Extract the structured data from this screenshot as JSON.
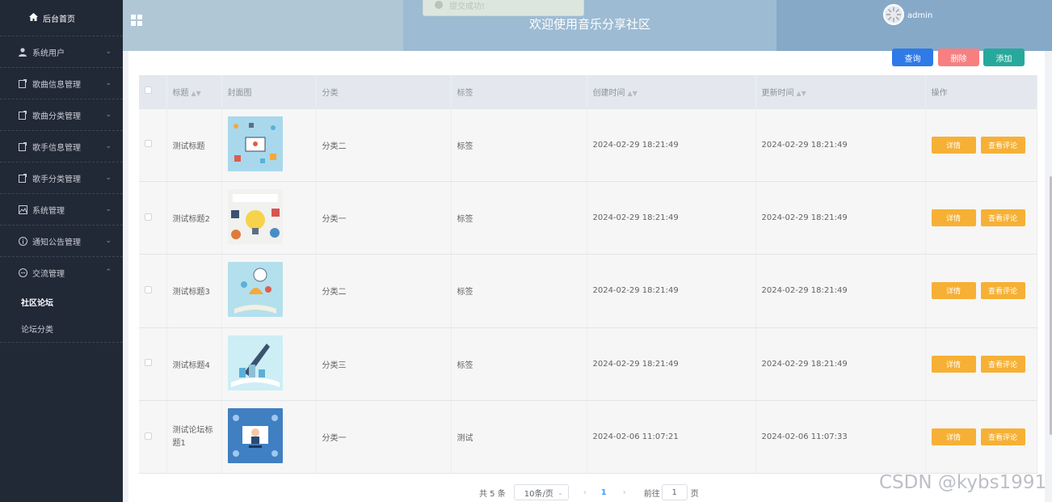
{
  "sidebar": {
    "home_label": "后台首页",
    "menus": [
      {
        "label": "系统用户",
        "icon": "user-icon"
      },
      {
        "label": "歌曲信息管理",
        "icon": "doc-icon"
      },
      {
        "label": "歌曲分类管理",
        "icon": "doc-icon"
      },
      {
        "label": "歌手信息管理",
        "icon": "doc-icon"
      },
      {
        "label": "歌手分类管理",
        "icon": "doc-icon"
      },
      {
        "label": "系统管理",
        "icon": "image-icon"
      },
      {
        "label": "通知公告管理",
        "icon": "info-icon"
      },
      {
        "label": "交流管理",
        "icon": "chat-icon",
        "expanded": true
      }
    ],
    "submenu": [
      {
        "label": "社区论坛",
        "active": true
      },
      {
        "label": "论坛分类",
        "active": false
      }
    ]
  },
  "header": {
    "title": "欢迎使用音乐分享社区",
    "toast": "提交成功!",
    "username": "admin"
  },
  "toolbar": {
    "query_label": "查询",
    "delete_label": "删除",
    "add_label": "添加"
  },
  "table": {
    "columns": [
      "标题",
      "封面图",
      "分类",
      "标签",
      "创建时间",
      "更新时间",
      "操作"
    ],
    "rows": [
      {
        "title": "测试标题",
        "category": "分类二",
        "tag": "标签",
        "created": "2024-02-29 18:21:49",
        "updated": "2024-02-29 18:21:49",
        "cover": "cover-1"
      },
      {
        "title": "测试标题2",
        "category": "分类一",
        "tag": "标签",
        "created": "2024-02-29 18:21:49",
        "updated": "2024-02-29 18:21:49",
        "cover": "cover-2"
      },
      {
        "title": "测试标题3",
        "category": "分类二",
        "tag": "标签",
        "created": "2024-02-29 18:21:49",
        "updated": "2024-02-29 18:21:49",
        "cover": "cover-3"
      },
      {
        "title": "测试标题4",
        "category": "分类三",
        "tag": "标签",
        "created": "2024-02-29 18:21:49",
        "updated": "2024-02-29 18:21:49",
        "cover": "cover-4"
      },
      {
        "title": "测试论坛标题1",
        "category": "分类一",
        "tag": "测试",
        "created": "2024-02-06 11:07:21",
        "updated": "2024-02-06 11:07:33",
        "cover": "cover-5"
      }
    ],
    "detail_label": "详情",
    "comment_label": "查看评论"
  },
  "pagination": {
    "total_label": "共 5 条",
    "page_size": "10条/页",
    "current_page": "1",
    "goto_label": "前往",
    "goto_value": "1",
    "page_suffix": "页"
  },
  "watermark": "CSDN @kybs1991",
  "colors": {
    "sidebar_bg": "#212836",
    "query": "#2f7ae6",
    "delete": "#f87f7f",
    "add": "#26a99a",
    "op": "#f6b035"
  }
}
